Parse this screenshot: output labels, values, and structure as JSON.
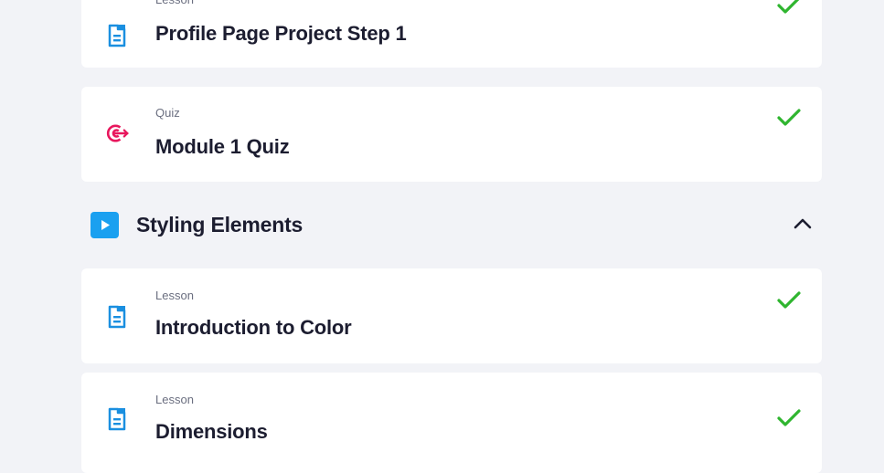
{
  "items_before": [
    {
      "kind": "Lesson",
      "title": "Profile Page Project Step 1",
      "icon": "lesson-document-icon",
      "completed": true
    },
    {
      "kind": "Quiz",
      "title": "Module 1 Quiz",
      "icon": "quiz-target-icon",
      "completed": true
    }
  ],
  "section": {
    "title": "Styling Elements",
    "icon": "play-icon",
    "expanded": true
  },
  "items_after": [
    {
      "kind": "Lesson",
      "title": "Introduction to Color",
      "icon": "lesson-document-icon",
      "completed": true
    },
    {
      "kind": "Lesson",
      "title": "Dimensions",
      "icon": "lesson-document-icon",
      "completed": true
    }
  ],
  "colors": {
    "background": "#f2f3f7",
    "card": "#ffffff",
    "lesson_icon": "#1a8fe0",
    "quiz_icon": "#e8175d",
    "check": "#2fb52f",
    "play_icon": "#1aa0f0",
    "text": "#1c1d30",
    "muted": "#6b6f80"
  }
}
